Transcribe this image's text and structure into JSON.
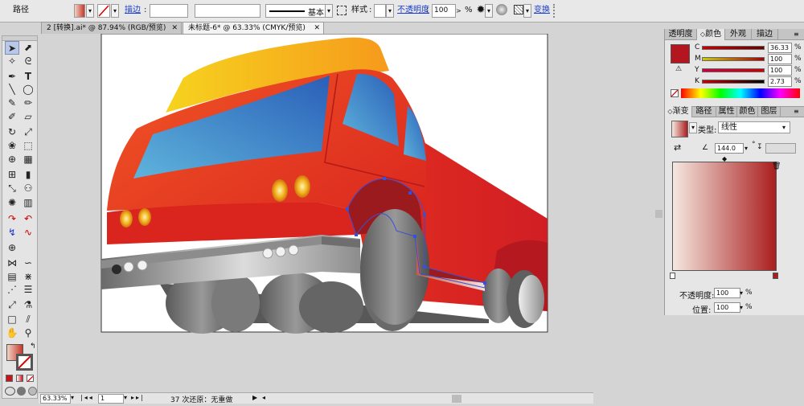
{
  "control_bar": {
    "mode_label": "路径",
    "stroke_label": "描边",
    "stroke_style_label": "基本",
    "style_label": "样式",
    "opacity_label": "不透明度",
    "opacity_value": "100",
    "percent": "%",
    "transform_label": "变换"
  },
  "doc_tabs": [
    {
      "label": "2 [转换].ai* @ 87.94% (RGB/预览)"
    },
    {
      "label": "未标题-6* @ 63.33% (CMYK/预览)"
    }
  ],
  "color_panel": {
    "tabs": [
      "透明度",
      "颜色",
      "外观",
      "描边"
    ],
    "channels": [
      {
        "letter": "C",
        "value": "36.33",
        "percent": "%"
      },
      {
        "letter": "M",
        "value": "100",
        "percent": "%"
      },
      {
        "letter": "Y",
        "value": "100",
        "percent": "%"
      },
      {
        "letter": "K",
        "value": "2.73",
        "percent": "%"
      }
    ],
    "fill_color": "#b4161f"
  },
  "gradient_panel": {
    "tabs": [
      "渐变",
      "路径",
      "属性",
      "颜色",
      "图层"
    ],
    "type_label": "类型:",
    "type_value": "线性",
    "angle_value": "144.0",
    "degree": "°",
    "opacity_label": "不透明度:",
    "opacity_value": "100",
    "position_label": "位置:",
    "position_value": "100",
    "percent": "%",
    "start_color": "#f4e8e0",
    "end_color": "#aa1e1e"
  },
  "status_bar": {
    "zoom": "63.33%",
    "page": "1",
    "status_text": "37 次还原：无重做"
  },
  "colors": {
    "truck_red": "#e12b1f",
    "windshield_blue": "#2f7cc8",
    "roof_yellow": "#f6b51c"
  }
}
